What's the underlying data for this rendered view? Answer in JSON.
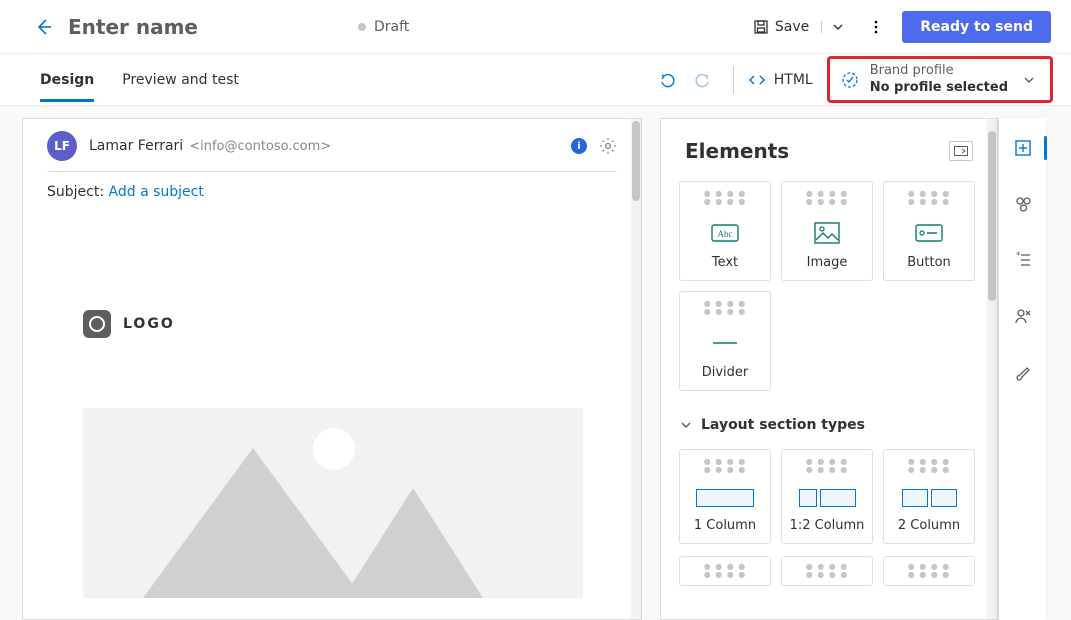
{
  "header": {
    "title_placeholder": "Enter name",
    "status": "Draft",
    "save_label": "Save",
    "ready_label": "Ready to send"
  },
  "toolbar": {
    "tabs": {
      "design": "Design",
      "preview": "Preview and test"
    },
    "html_label": "HTML",
    "brand_label": "Brand profile",
    "brand_value": "No profile selected"
  },
  "canvas": {
    "from_initials": "LF",
    "from_name": "Lamar Ferrari",
    "from_email": "<info@contoso.com>",
    "subject_label": "Subject:",
    "subject_link": "Add a subject",
    "logo_text": "LOGO"
  },
  "elements": {
    "title": "Elements",
    "tiles": {
      "text": "Text",
      "image": "Image",
      "button": "Button",
      "divider": "Divider"
    },
    "section_header": "Layout section types",
    "layouts": {
      "col1": "1 Column",
      "col12": "1:2 Column",
      "col2": "2 Column"
    }
  }
}
